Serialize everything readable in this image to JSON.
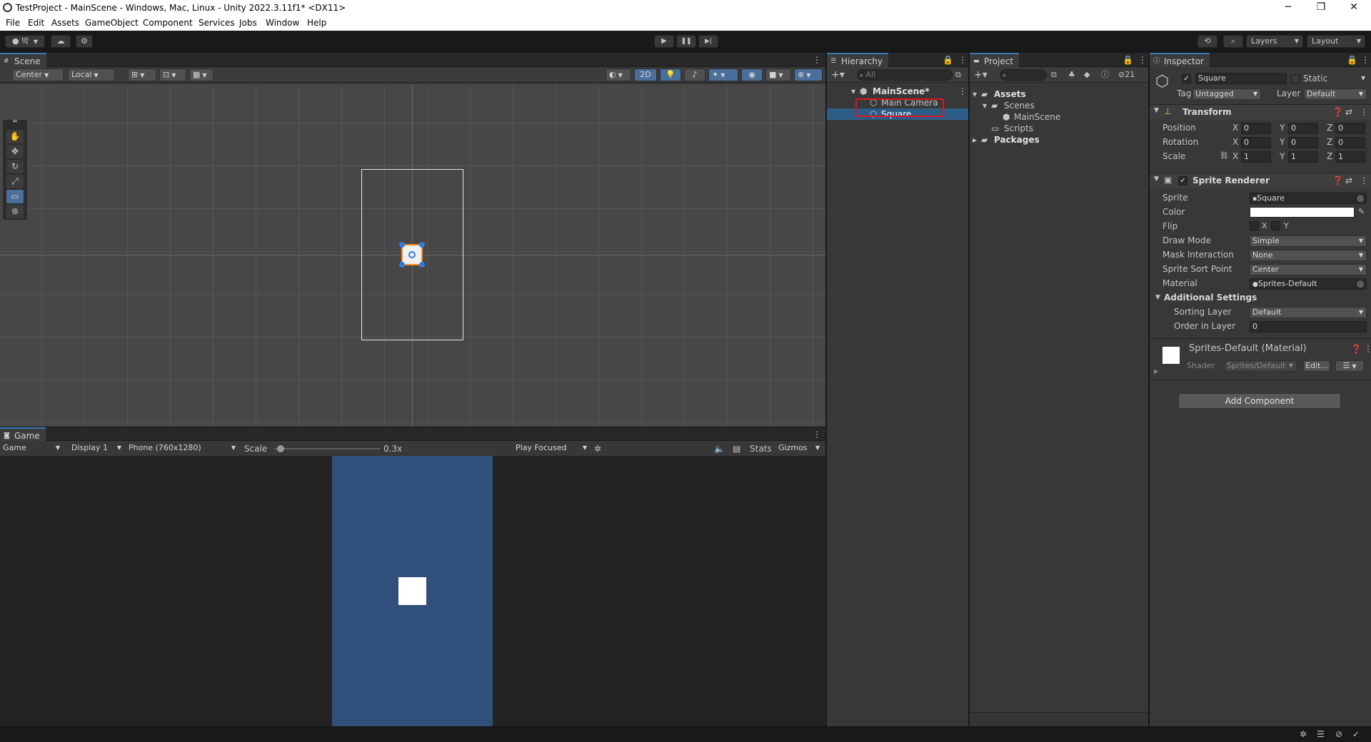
{
  "window": {
    "title": "TestProject - MainScene - Windows, Mac, Linux - Unity 2022.3.11f1* <DX11>",
    "controls": {
      "minimize": "─",
      "maximize": "❐",
      "close": "✕"
    }
  },
  "menu": [
    "File",
    "Edit",
    "Assets",
    "GameObject",
    "Component",
    "Services",
    "Jobs",
    "Window",
    "Help"
  ],
  "toolbar": {
    "account_label": "박",
    "play": "▶",
    "pause": "❚❚",
    "step": "▶|",
    "layers": "Layers",
    "layout": "Layout"
  },
  "scene": {
    "tab": "Scene",
    "pivot": "Center",
    "space": "Local",
    "mode_2d": "2D"
  },
  "game": {
    "tab": "Game",
    "view_select": "Game",
    "display": "Display 1",
    "resolution": "Phone (760x1280)",
    "scale_label": "Scale",
    "scale_value": "0.3x",
    "scale_fraction": 0.03,
    "play_mode": "Play Focused",
    "stats": "Stats",
    "gizmos": "Gizmos"
  },
  "hierarchy": {
    "tab": "Hierarchy",
    "search_placeholder": "All",
    "items": [
      {
        "label": "MainScene*"
      },
      {
        "label": "Main Camera"
      },
      {
        "label": "Square"
      }
    ]
  },
  "project": {
    "tab": "Project",
    "hidden_count": "21",
    "tree": [
      {
        "label": "Assets"
      },
      {
        "label": "Scenes"
      },
      {
        "label": "MainScene"
      },
      {
        "label": "Scripts"
      },
      {
        "label": "Packages"
      }
    ]
  },
  "inspector": {
    "tab": "Inspector",
    "object_name": "Square",
    "static_label": "Static",
    "tag_label": "Tag",
    "tag_value": "Untagged",
    "layer_label": "Layer",
    "layer_value": "Default",
    "transform": {
      "title": "Transform",
      "position_label": "Position",
      "rotation_label": "Rotation",
      "scale_label": "Scale",
      "axis_x": "X",
      "axis_y": "Y",
      "axis_z": "Z",
      "position": [
        "0",
        "0",
        "0"
      ],
      "rotation": [
        "0",
        "0",
        "0"
      ],
      "scale": [
        "1",
        "1",
        "1"
      ]
    },
    "sprite_renderer": {
      "title": "Sprite Renderer",
      "sprite_label": "Sprite",
      "sprite_value": "Square",
      "color_label": "Color",
      "flip_label": "Flip",
      "flip_x": "X",
      "flip_y": "Y",
      "draw_mode_label": "Draw Mode",
      "draw_mode_value": "Simple",
      "mask_label": "Mask Interaction",
      "mask_value": "None",
      "sort_point_label": "Sprite Sort Point",
      "sort_point_value": "Center",
      "material_label": "Material",
      "material_value": "Sprites-Default",
      "additional_label": "Additional Settings",
      "sorting_layer_label": "Sorting Layer",
      "sorting_layer_value": "Default",
      "order_label": "Order in Layer",
      "order_value": "0"
    },
    "material": {
      "title": "Sprites-Default (Material)",
      "shader_label": "Shader",
      "shader_value": "Sprites/Default",
      "edit_button": "Edit..."
    },
    "add_component": "Add Component"
  },
  "colors": {
    "accent": "#3a79bb",
    "highlight_box": "#e0141e",
    "game_camera_bg": "#30507b"
  }
}
